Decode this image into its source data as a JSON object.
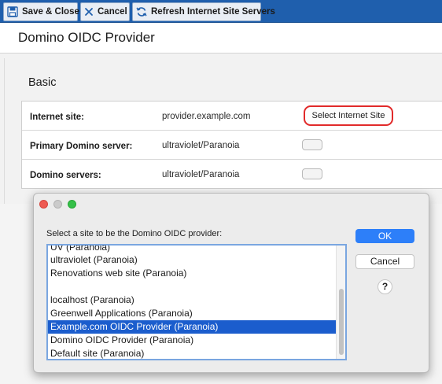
{
  "toolbar": {
    "save_close": "Save & Close",
    "cancel": "Cancel",
    "refresh": "Refresh Internet Site Servers"
  },
  "document": {
    "title": "Domino OIDC Provider"
  },
  "basic": {
    "section_title": "Basic",
    "rows": [
      {
        "label": "Internet site:",
        "value": "provider.example.com",
        "button": "Select Internet Site"
      },
      {
        "label": "Primary Domino server:",
        "value": "ultraviolet/Paranoia"
      },
      {
        "label": "Domino servers:",
        "value": "ultraviolet/Paranoia"
      }
    ]
  },
  "dialog": {
    "prompt": "Select a site to be the Domino OIDC provider:",
    "ok": "OK",
    "cancel": "Cancel",
    "help": "?",
    "items": [
      "UV (Paranoia)",
      "ultraviolet (Paranoia)",
      "Renovations web site (Paranoia)",
      "",
      "localhost (Paranoia)",
      "Greenwell Applications (Paranoia)",
      "Example.com OIDC Provider (Paranoia)",
      "Domino OIDC Provider (Paranoia)",
      "Default site (Paranoia)"
    ],
    "selected_index": 6
  },
  "colors": {
    "toolbar": "#1f5fad",
    "selection": "#1b5dcd",
    "highlight": "#e12a2a",
    "ok_button": "#2d7ff9"
  },
  "icons": [
    "save-icon",
    "close-x-icon",
    "refresh-icon",
    "question-icon"
  ]
}
